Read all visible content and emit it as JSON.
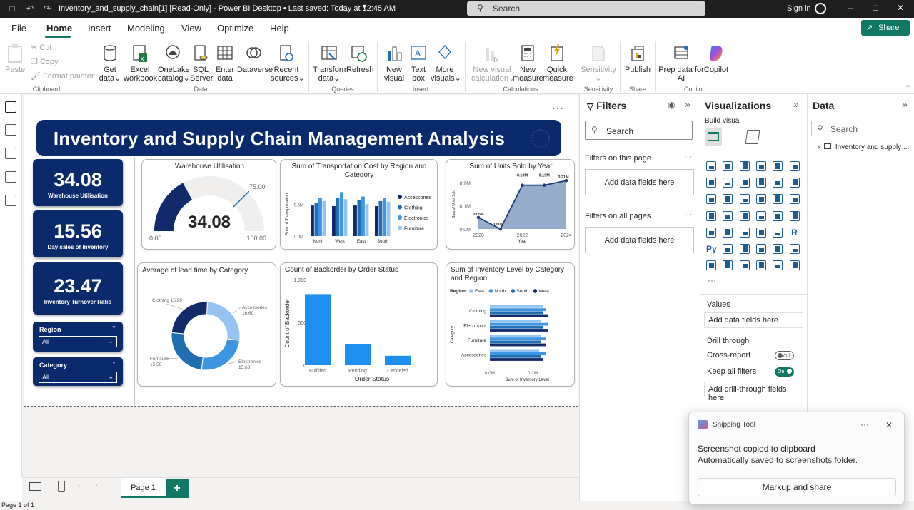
{
  "titlebar": {
    "title": "Inventory_and_supply_chain[1] [Read-Only] - Power BI Desktop  •  Last saved: Today at 12:45 AM",
    "search_placeholder": "Search",
    "signin": "Sign in"
  },
  "menu": {
    "items": [
      "File",
      "Home",
      "Insert",
      "Modeling",
      "View",
      "Optimize",
      "Help"
    ],
    "share": "Share"
  },
  "ribbon": {
    "clipboard": {
      "paste": "Paste",
      "cut": "Cut",
      "copy": "Copy",
      "format_painter": "Format painter",
      "group": "Clipboard"
    },
    "data": {
      "get_data": [
        "Get",
        "data"
      ],
      "excel": [
        "Excel",
        "workbook"
      ],
      "onelake": [
        "OneLake",
        "catalog"
      ],
      "sql": [
        "SQL",
        "Server"
      ],
      "enter": [
        "Enter",
        "data"
      ],
      "dataverse": [
        "Dataverse"
      ],
      "recent": [
        "Recent",
        "sources"
      ],
      "group": "Data"
    },
    "queries": {
      "transform": [
        "Transform",
        "data"
      ],
      "refresh": [
        "Refresh"
      ],
      "group": "Queries"
    },
    "insert": {
      "new_visual": [
        "New",
        "visual"
      ],
      "text_box": [
        "Text",
        "box"
      ],
      "more_visuals": [
        "More",
        "visuals"
      ],
      "group": "Insert"
    },
    "calculations": {
      "new_visual_calc": [
        "New visual",
        "calculation"
      ],
      "new_measure": [
        "New",
        "measure"
      ],
      "quick_measure": [
        "Quick",
        "measure"
      ],
      "group": "Calculations"
    },
    "sensitivity": {
      "label": [
        "Sensitivity"
      ],
      "group": "Sensitivity"
    },
    "share": {
      "publish": [
        "Publish"
      ],
      "group": "Share"
    },
    "copilot": {
      "prep": [
        "Prep data for",
        "AI"
      ],
      "copilot": [
        "Copilot"
      ],
      "group": "Copilot"
    }
  },
  "report": {
    "banner_title": "Inventory and Supply Chain Management Analysis",
    "more": "···",
    "kpis": [
      {
        "value": "34.08",
        "label": "Warehouse Utilisation"
      },
      {
        "value": "15.56",
        "label": "Day sales of Inventory"
      },
      {
        "value": "23.47",
        "label": "Inventory Turnover Ratio"
      }
    ],
    "slicers": [
      {
        "title": "Region",
        "value": "All"
      },
      {
        "title": "Category",
        "value": "All"
      }
    ]
  },
  "chart_data": [
    {
      "type": "gauge",
      "title": "Warehouse Utilisation",
      "value": 34.08,
      "min": 0,
      "max": 100,
      "target": 75,
      "min_label": "0.00",
      "max_label": "100.00",
      "target_label": "75.00",
      "value_label": "34.08",
      "colors": {
        "fill": "#12296a",
        "track": "#f0efee",
        "target": "#1f6fb2"
      }
    },
    {
      "type": "bar",
      "title": "Sum of Transportation Cost by Region and Category",
      "categories": [
        "North",
        "West",
        "East",
        "South"
      ],
      "series": [
        {
          "name": "Accessories",
          "values": [
            0.48,
            0.47,
            0.48,
            0.47
          ],
          "color": "#12296a"
        },
        {
          "name": "Clothing",
          "values": [
            0.52,
            0.6,
            0.56,
            0.55
          ],
          "color": "#1f6fb2"
        },
        {
          "name": "Electronics",
          "values": [
            0.6,
            0.69,
            0.62,
            0.6
          ],
          "color": "#3f96e0"
        },
        {
          "name": "Furniture",
          "values": [
            0.55,
            0.58,
            0.5,
            0.54
          ],
          "color": "#95c4f0"
        }
      ],
      "ylabel": "Sum of Transportation...",
      "yticks": [
        "0.0M",
        "0.5M"
      ],
      "ylim": [
        0,
        0.75
      ]
    },
    {
      "type": "area",
      "title": "Sum of Units Sold by Year",
      "x": [
        2020,
        2021,
        2022,
        2023,
        2024
      ],
      "values": [
        0.05,
        0.0,
        0.19,
        0.19,
        0.21
      ],
      "data_labels": [
        "0.05M",
        "0.00M",
        "0.19M",
        "0.19M",
        "0.21M"
      ],
      "xticks": [
        "2020",
        "2022",
        "2024"
      ],
      "yticks": [
        "0.0M",
        "0.1M",
        "0.2M"
      ],
      "ylim": [
        0,
        0.22
      ],
      "xlabel": "Year",
      "ylabel": "Sum of Units Sold",
      "colors": {
        "line": "#1c3f7a",
        "area": "#8aa3c4"
      }
    },
    {
      "type": "pie",
      "title": "Average of lead time by Category",
      "slices": [
        {
          "label": "Accessories",
          "value": 16.6,
          "value_label": "16.60",
          "color": "#95c4f0"
        },
        {
          "label": "Electronics",
          "value": 15.68,
          "value_label": "15.68",
          "color": "#3f96e0"
        },
        {
          "label": "Furniture",
          "value": 15.5,
          "value_label": "15.50",
          "color": "#1f6fb2"
        },
        {
          "label": "Clothing",
          "value": 15.29,
          "value_label": "15.29",
          "color": "#12296a"
        }
      ]
    },
    {
      "type": "bar",
      "title": "Count of Backorder by Order Status",
      "categories": [
        "Fulfilled",
        "Pending",
        "Canceled"
      ],
      "values": [
        830,
        250,
        110
      ],
      "xlabel": "Order Status",
      "ylabel": "Count of Backorder",
      "yticks": [
        "0",
        "500",
        "1,000"
      ],
      "ylim": [
        0,
        1000
      ],
      "color": "#1e8ff0"
    },
    {
      "type": "bar",
      "orientation": "horizontal",
      "title": "Sum of Inventory Level by Category and Region",
      "legend_title": "Region",
      "categories": [
        "Clothing",
        "Electronics",
        "Furniture",
        "Accessories"
      ],
      "series": [
        {
          "name": "East",
          "values": [
            0.25,
            0.24,
            0.24,
            0.23
          ],
          "color": "#95c4f0"
        },
        {
          "name": "North",
          "values": [
            0.26,
            0.27,
            0.26,
            0.26
          ],
          "color": "#3f96e0"
        },
        {
          "name": "South",
          "values": [
            0.25,
            0.25,
            0.24,
            0.24
          ],
          "color": "#1f6fb2"
        },
        {
          "name": "West",
          "values": [
            0.27,
            0.27,
            0.26,
            0.25
          ],
          "color": "#12296a"
        }
      ],
      "xticks": [
        "0.0M",
        "0.2M"
      ],
      "xlim": [
        0,
        0.33
      ],
      "xlabel": "Sum of Inventory Level",
      "ylabel": "Category"
    }
  ],
  "filters": {
    "title": "Filters",
    "search": "Search",
    "on_page": "Filters on this page",
    "on_all": "Filters on all pages",
    "add": "Add data fields here"
  },
  "viz": {
    "title": "Visualizations",
    "build": "Build visual",
    "more": "···",
    "values": "Values",
    "values_drop": "Add data fields here",
    "drill": "Drill through",
    "cross": "Cross-report",
    "cross_state": "Off",
    "keep": "Keep all filters",
    "keep_state": "On",
    "drill_drop": "Add drill-through fields here"
  },
  "datapane": {
    "title": "Data",
    "search": "Search",
    "table": "Inventory and supply ..."
  },
  "pages": {
    "tab": "Page 1",
    "add": "+",
    "status": "Page 1 of 1"
  },
  "toast": {
    "app": "Snipping Tool",
    "heading": "Screenshot copied to clipboard",
    "body": "Automatically saved to screenshots folder.",
    "button": "Markup and share"
  }
}
